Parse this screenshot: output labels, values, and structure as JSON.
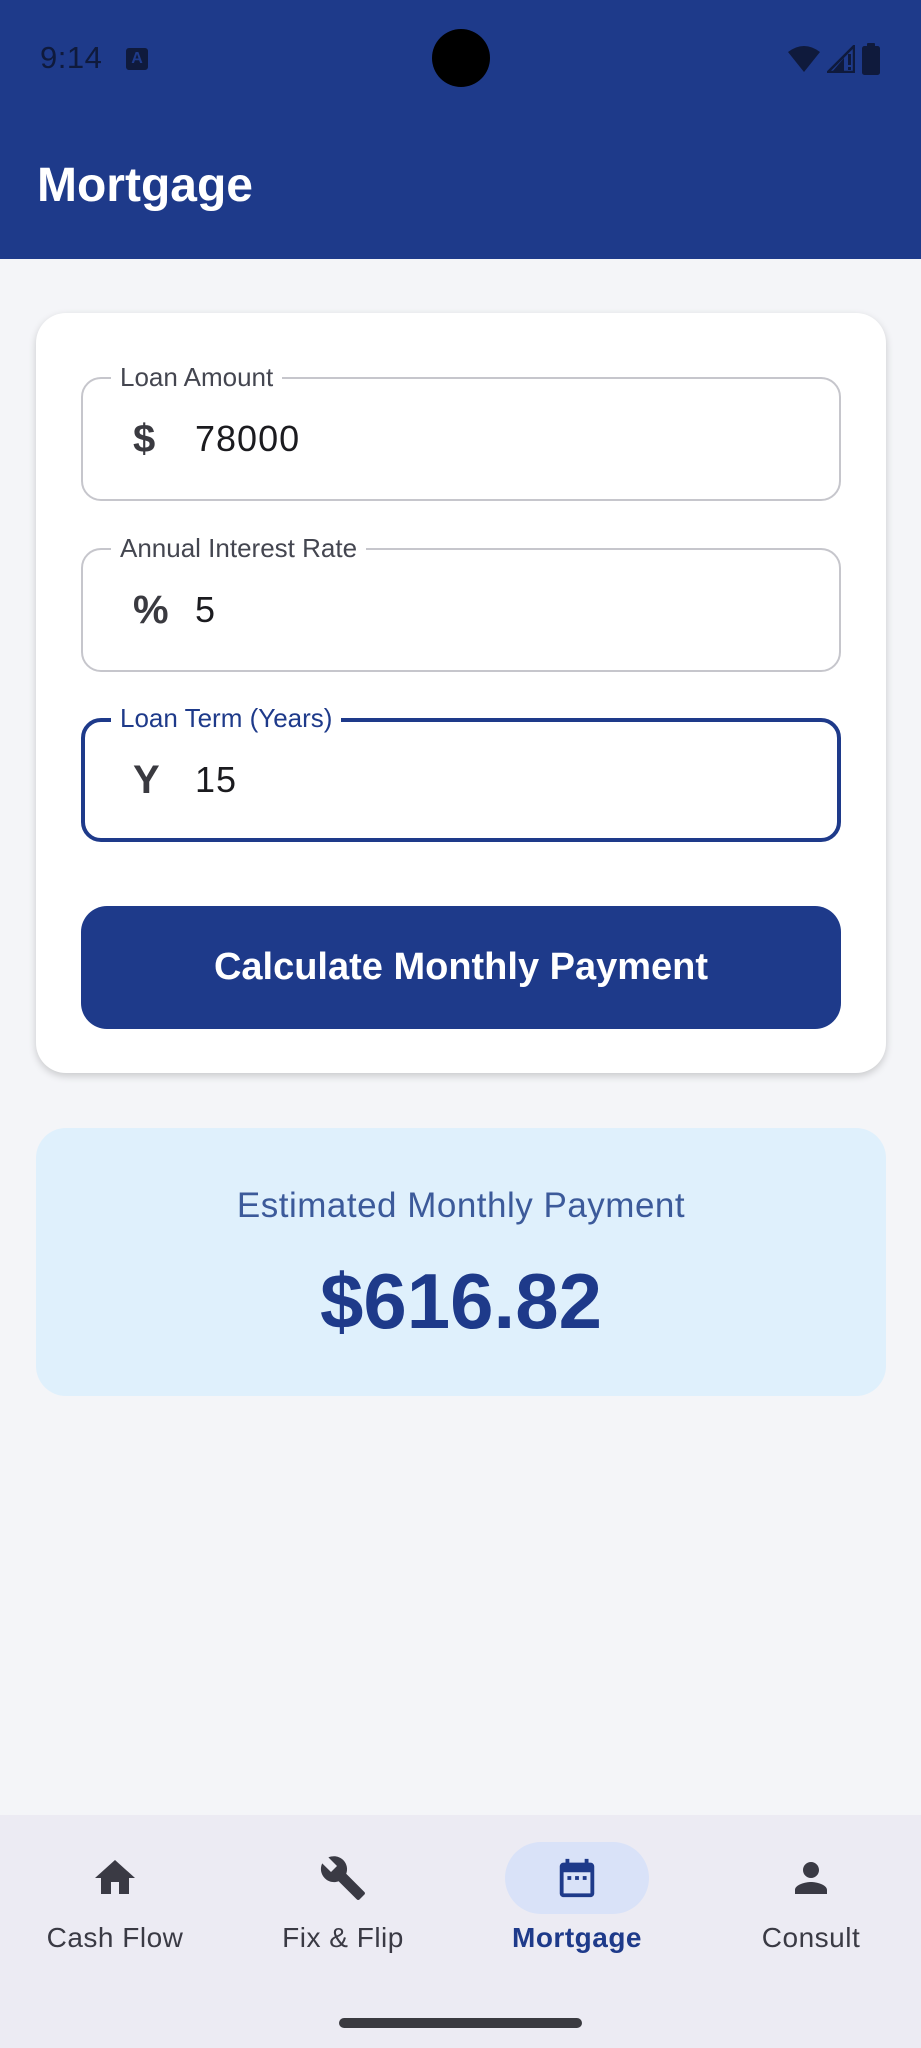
{
  "status_bar": {
    "time": "9:14",
    "notification_icon": "a-letter-icon"
  },
  "app_bar": {
    "title": "Mortgage"
  },
  "form": {
    "loan_amount": {
      "label": "Loan Amount",
      "prefix": "$",
      "value": "78000"
    },
    "interest_rate": {
      "label": "Annual Interest Rate",
      "prefix": "%",
      "value": "5"
    },
    "loan_term": {
      "label": "Loan Term (Years)",
      "prefix": "Y",
      "value": "15"
    },
    "calculate_label": "Calculate Monthly Payment"
  },
  "result": {
    "label": "Estimated Monthly Payment",
    "value": "$616.82"
  },
  "nav": {
    "items": [
      {
        "label": "Cash Flow",
        "icon": "home-icon"
      },
      {
        "label": "Fix & Flip",
        "icon": "wrench-icon"
      },
      {
        "label": "Mortgage",
        "icon": "calendar-icon",
        "active": true
      },
      {
        "label": "Consult",
        "icon": "person-icon"
      }
    ]
  },
  "colors": {
    "primary": "#1e3a8a",
    "background": "#f4f5f8",
    "result_background": "#dff0fc",
    "nav_background": "#ecebf3",
    "active_pill": "#d9e2f8"
  }
}
